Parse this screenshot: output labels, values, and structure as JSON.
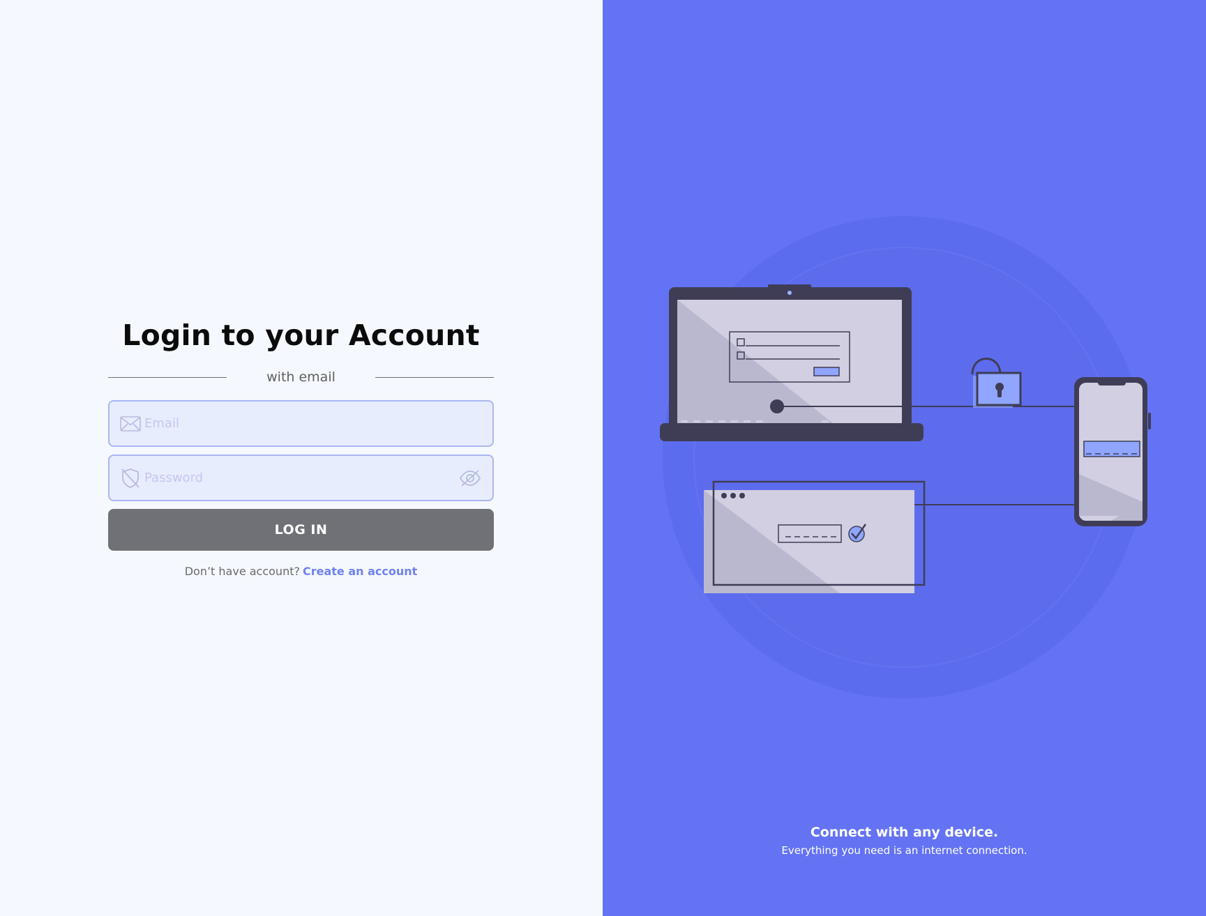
{
  "login": {
    "title": "Login to your Account",
    "divider_text": "with email",
    "email_placeholder": "Email",
    "password_placeholder": "Password",
    "login_button": "LOG IN",
    "signup_prompt": "Don’t have account?",
    "signup_link": "Create an account"
  },
  "promo": {
    "headline": "Connect with any device.",
    "subline": "Everything you need is an internet connection."
  },
  "colors": {
    "page_bg": "#f5f8fe",
    "panel_bg": "#6373f3",
    "button_bg": "#707176",
    "link": "#6f82ee",
    "field_border": "#a9b7f2",
    "field_bg": "#e8edfd"
  },
  "icons": {
    "email": "envelope-icon",
    "password": "shield-icon",
    "visibility": "eye-off-icon"
  }
}
